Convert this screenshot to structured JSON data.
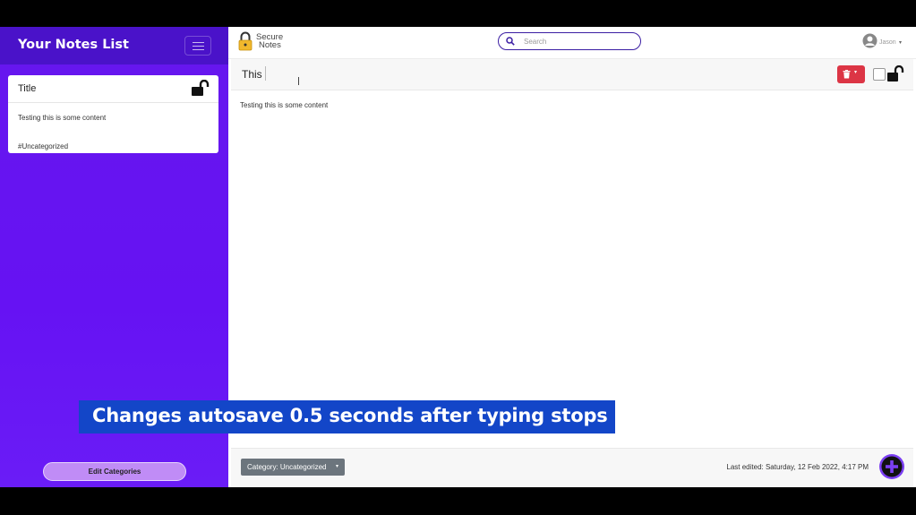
{
  "sidebar": {
    "title": "Your Notes List",
    "notes": [
      {
        "title": "Title",
        "content": "Testing this is some content",
        "category": "#Uncategorized"
      }
    ],
    "edit_categories_label": "Edit Categories"
  },
  "navbar": {
    "logo_line1": "Secure",
    "logo_line2": "Notes",
    "search_placeholder": "Search",
    "user_name": "Jason",
    "user_caret": "▾"
  },
  "editor": {
    "note_title": "This",
    "note_body": "Testing this is some content",
    "category_label": "Category: Uncategorized",
    "dropdown_caret": "▾",
    "last_edited": "Last edited: Saturday, 12 Feb 2022, 4:17 PM"
  },
  "caption": {
    "text": "Changes autosave 0.5 seconds after typing stops"
  },
  "colors": {
    "sidebar_bg": "#6612f3",
    "sidebar_header": "#4a12c9",
    "delete_red": "#dc3545",
    "caption_blue": "#1346c8",
    "add_purple": "#7b3ff2"
  }
}
